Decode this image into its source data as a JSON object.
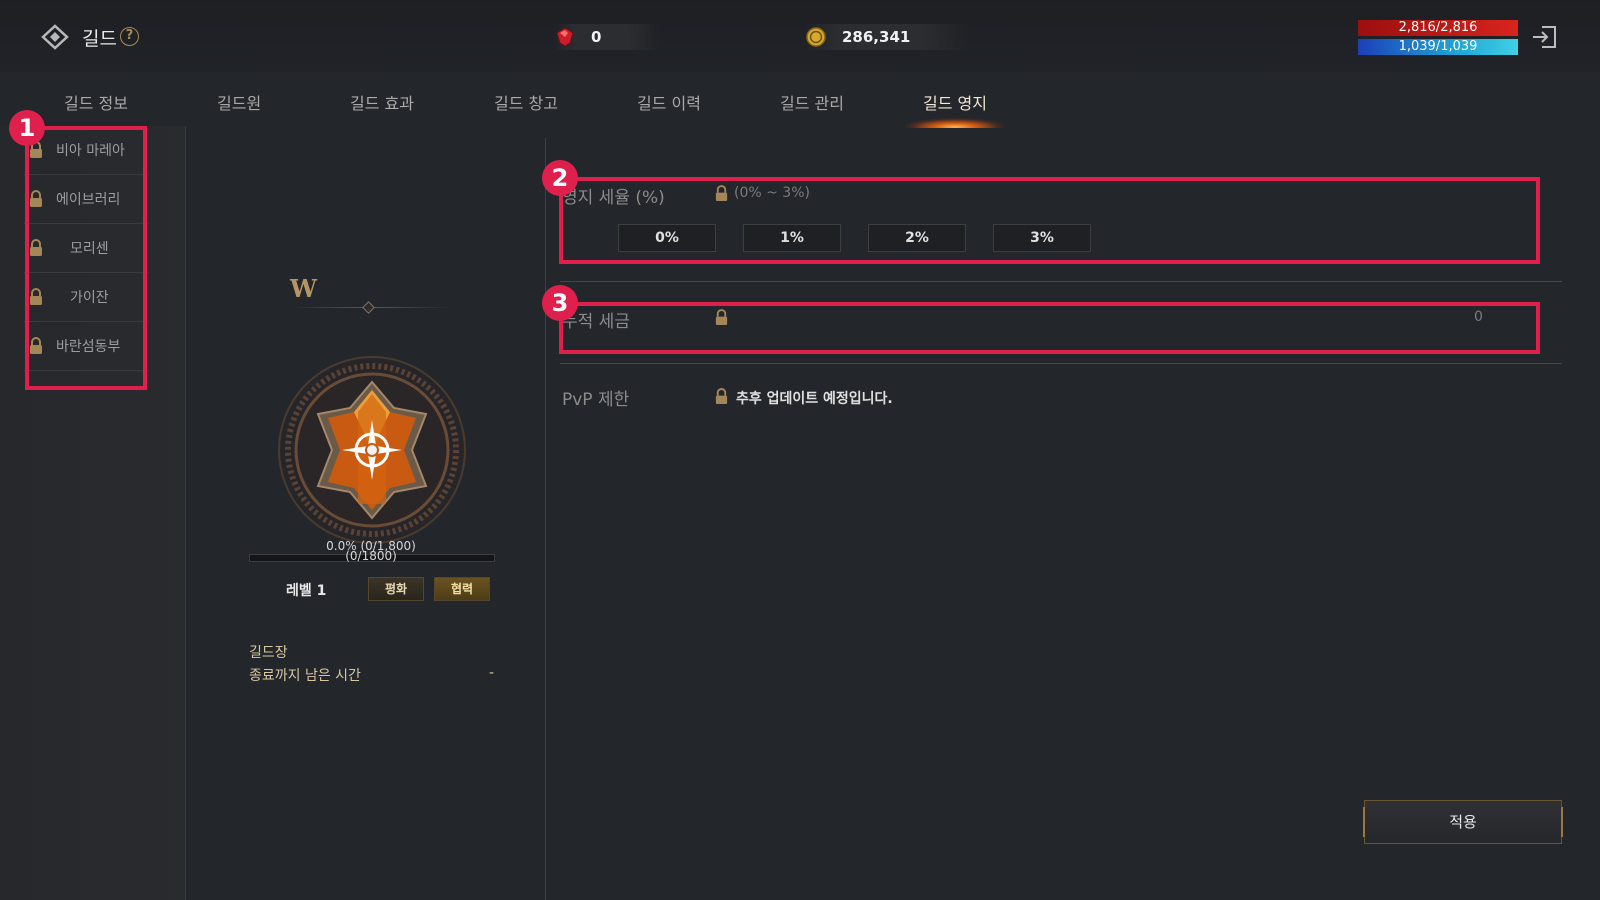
{
  "header": {
    "title": "길드",
    "help_symbol": "?",
    "gems": "0",
    "gold": "286,341",
    "hp": "2,816/2,816",
    "mp": "1,039/1,039"
  },
  "tabs": [
    {
      "label": "길드 정보"
    },
    {
      "label": "길드원"
    },
    {
      "label": "길드 효과"
    },
    {
      "label": "길드 창고"
    },
    {
      "label": "길드 이력"
    },
    {
      "label": "길드 관리"
    },
    {
      "label": "길드 영지"
    }
  ],
  "active_tab": "길드 영지",
  "sidebar": {
    "items": [
      {
        "label": "비아 마레아"
      },
      {
        "label": "에이브러리"
      },
      {
        "label": "모리센"
      },
      {
        "label": "가이잔"
      },
      {
        "label": "바란섬동부"
      }
    ]
  },
  "guild": {
    "exp_percent_text": "0.0% (0/1,800)",
    "exp_raw_text": "(0/1800)",
    "exp_progress": 0.0,
    "level": "레벨 1",
    "peace_label": "평화",
    "coop_label": "협력",
    "leader_label": "길드장",
    "remaining_label": "종료까지 남은 시간",
    "remaining_value": "-"
  },
  "territory": {
    "tax_label": "영지 세율 (%)",
    "tax_range": "(0% ~ 3%)",
    "tax_options": [
      "0%",
      "1%",
      "2%",
      "3%"
    ],
    "accumulated_label": "누적 세금",
    "accumulated_value": "0",
    "pvp_label": "PvP 제한",
    "pvp_note": "추후 업데이트 예정입니다."
  },
  "apply_label": "적용",
  "annotations": [
    "1",
    "2",
    "3"
  ],
  "colors": {
    "background": "#23262b",
    "highlight": "#e0204c",
    "gold_accent": "#a88a56",
    "hp_bar": "#d8241c",
    "mp_bar": "#1ea3d6"
  }
}
